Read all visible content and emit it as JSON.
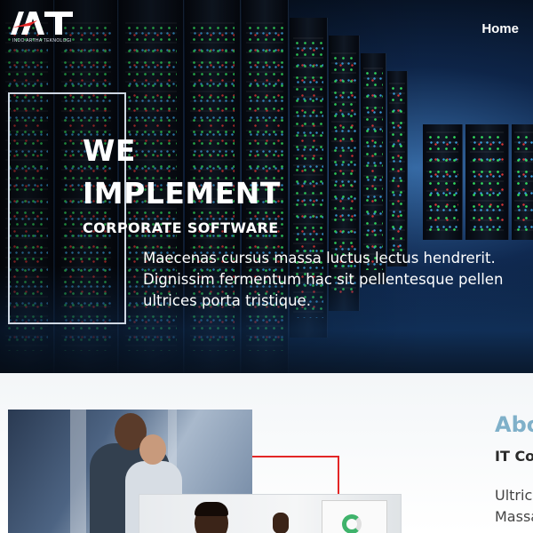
{
  "logo": {
    "mark": "IAT",
    "tagline": "INDO ARTHA TEKNOLOGI",
    "colors": {
      "primary": "#ffffff",
      "accent": "#e32626"
    }
  },
  "nav": {
    "home": "Home"
  },
  "hero": {
    "line1": "WE",
    "line2": "IMPLEMENT",
    "subtitle": "CORPORATE SOFTWARE",
    "description": [
      "Maecenas cursus massa luctus lectus hendrerit.",
      "Dignissim fermentum hac sit pellentesque pellen",
      "ultrices porta tristique."
    ]
  },
  "about": {
    "title": "Abo",
    "subtitle": "IT Co",
    "text": [
      "Ultric",
      "Massa"
    ],
    "accent_line_color": "#e32626"
  }
}
